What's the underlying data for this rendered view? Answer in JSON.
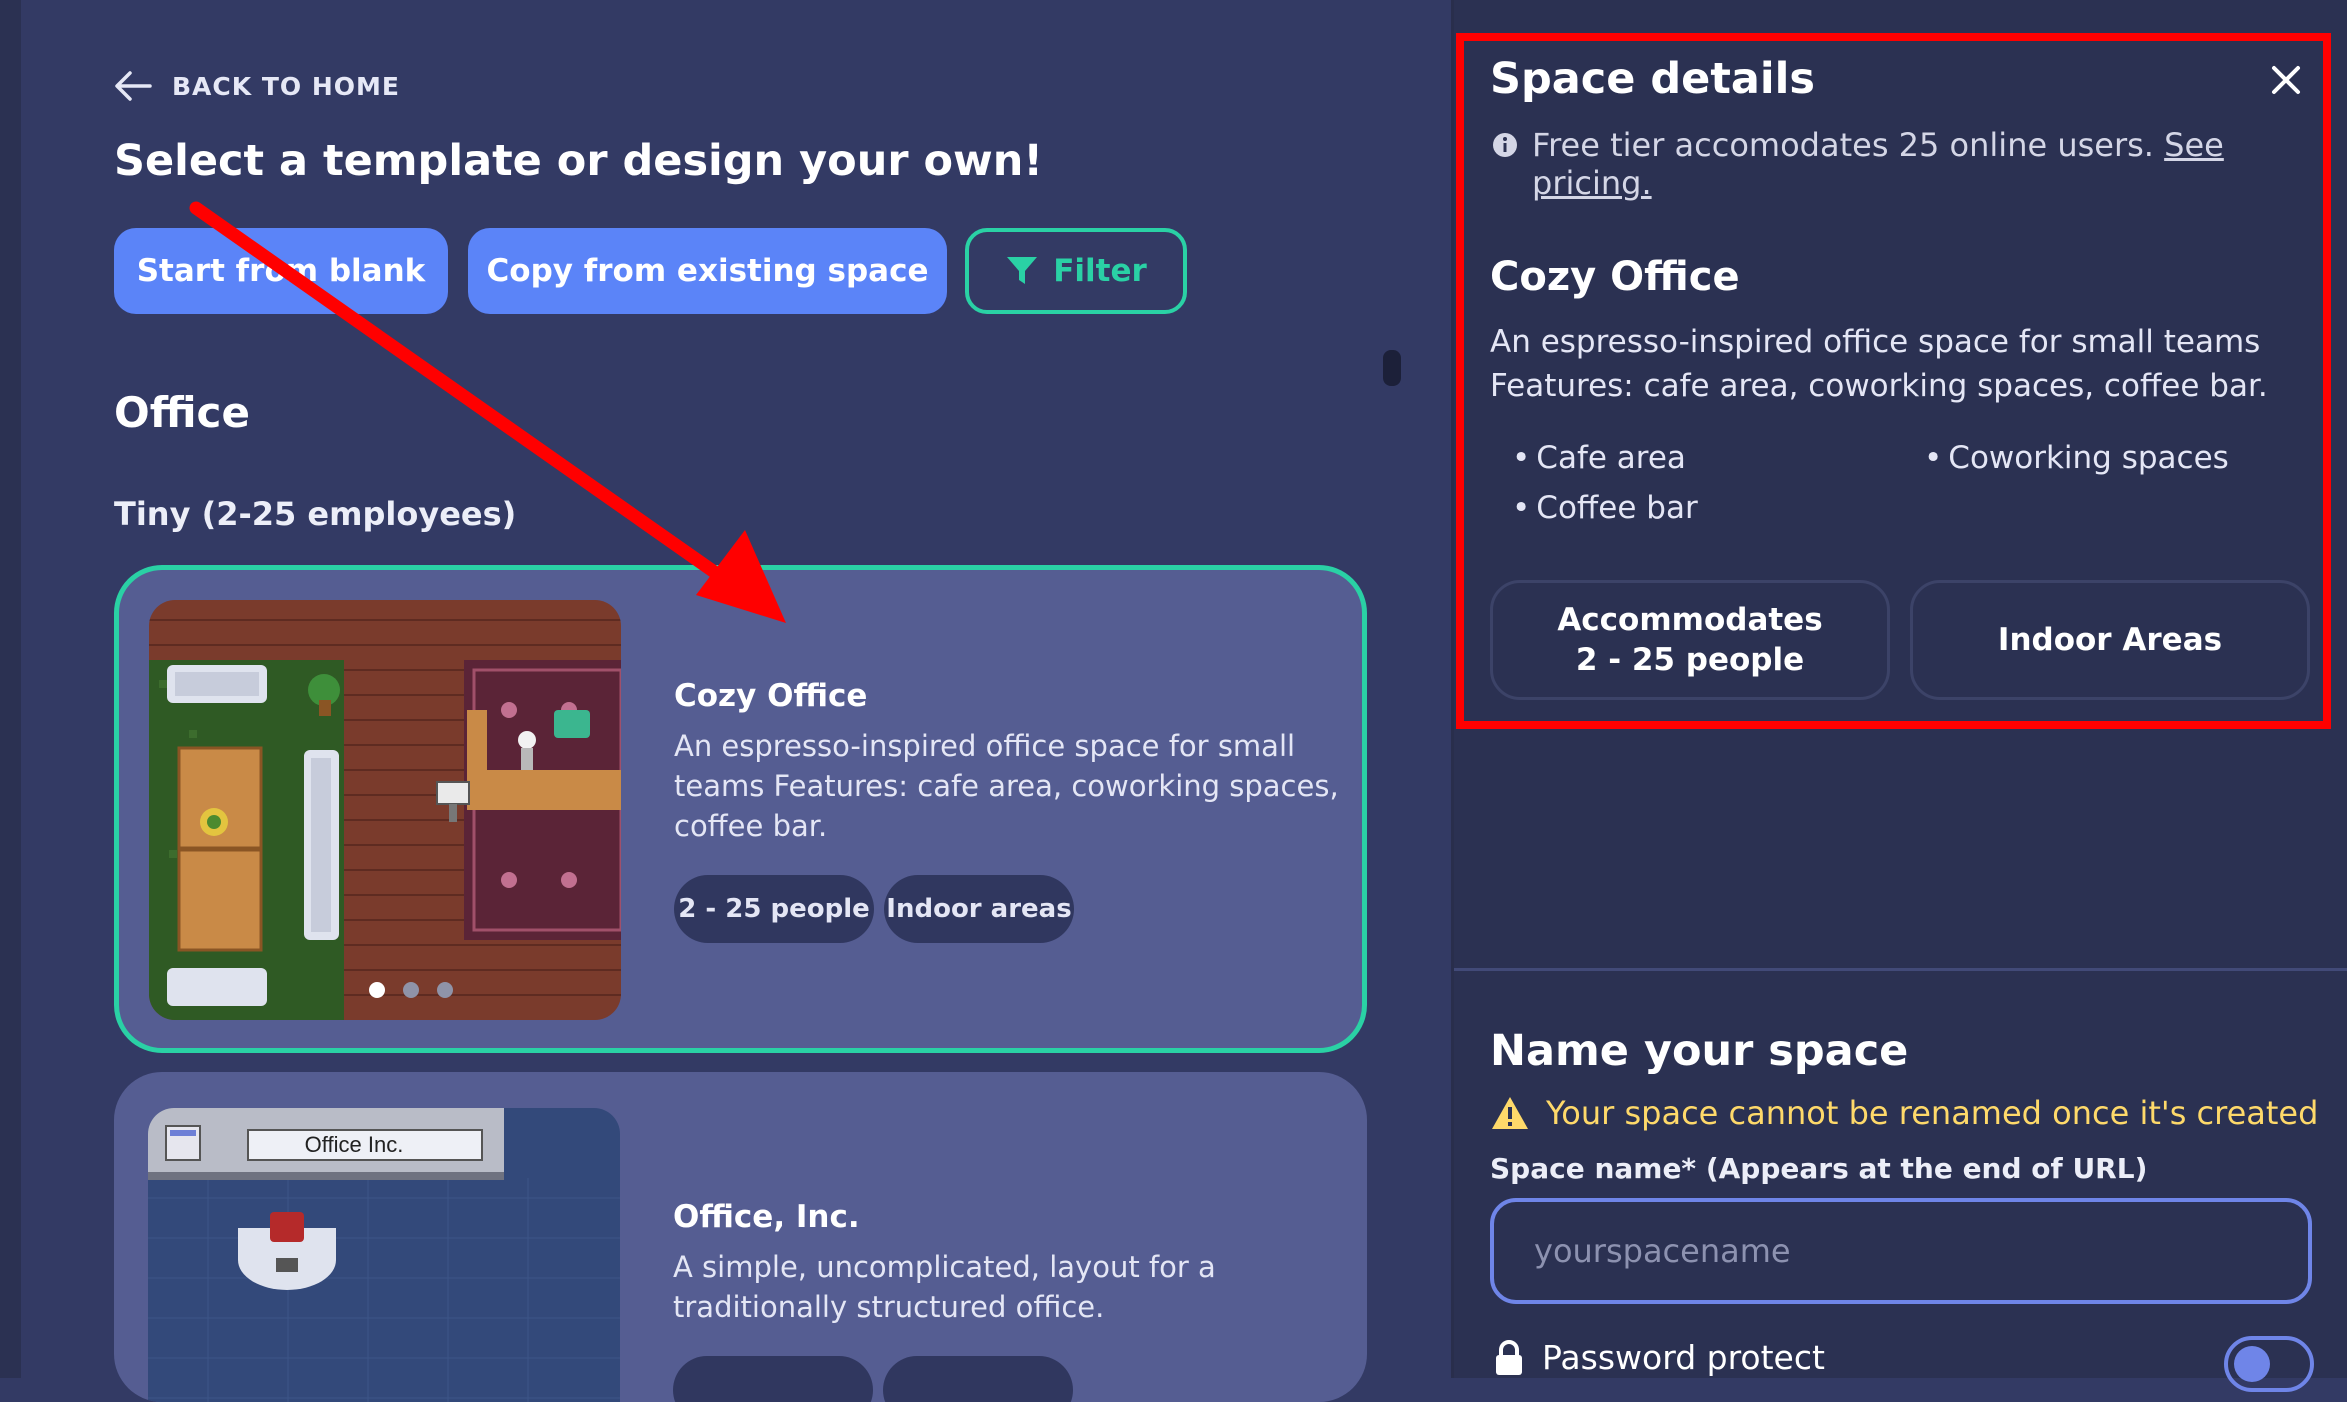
{
  "nav": {
    "back_label": "BACK TO HOME"
  },
  "page": {
    "title": "Select a template or design your own!"
  },
  "actions": {
    "start_blank": "Start from blank",
    "copy_existing": "Copy from existing space",
    "filter": "Filter"
  },
  "section": {
    "title": "Office",
    "subtitle": "Tiny (2-25 employees)"
  },
  "templates": [
    {
      "title": "Cozy Office",
      "description": "An espresso-inspired office space for small teams Features: cafe area, coworking spaces, coffee bar.",
      "tags": [
        "2 - 25 people",
        "Indoor areas"
      ],
      "selected": true,
      "thumbnail_label": ""
    },
    {
      "title": "Office, Inc.",
      "description": "A simple, uncomplicated, layout for a traditionally structured office.",
      "tags": [
        "",
        ""
      ],
      "selected": false,
      "thumbnail_label": "Office Inc."
    }
  ],
  "details": {
    "title": "Space details",
    "info_text": "Free tier accomodates 25 online users.",
    "info_link": "See pricing.",
    "template_name": "Cozy Office",
    "template_desc_line1": "An espresso-inspired office space for small teams",
    "template_desc_line2": "Features: cafe area, coworking spaces, coffee bar.",
    "features": [
      "Cafe area",
      "Coworking spaces",
      "Coffee bar"
    ],
    "capacity_line1": "Accommodates",
    "capacity_line2": "2 - 25 people",
    "area_type": "Indoor Areas"
  },
  "name_space": {
    "title": "Name your space",
    "warning": "Your space cannot be renamed once it's created",
    "field_label": "Space name* (Appears at the end of URL)",
    "placeholder": "yourspacename",
    "value": "",
    "password_label": "Password protect",
    "password_enabled": false
  },
  "icons": {
    "back": "arrow-left-icon",
    "filter": "funnel-icon",
    "close": "close-icon",
    "info": "info-circle-icon",
    "warning": "warning-triangle-icon",
    "lock": "lock-icon"
  },
  "colors": {
    "accent_blue": "#5b84f8",
    "accent_green": "#2ad1a5",
    "warning_yellow": "#fed96a",
    "annotation_red": "#ff0000"
  }
}
